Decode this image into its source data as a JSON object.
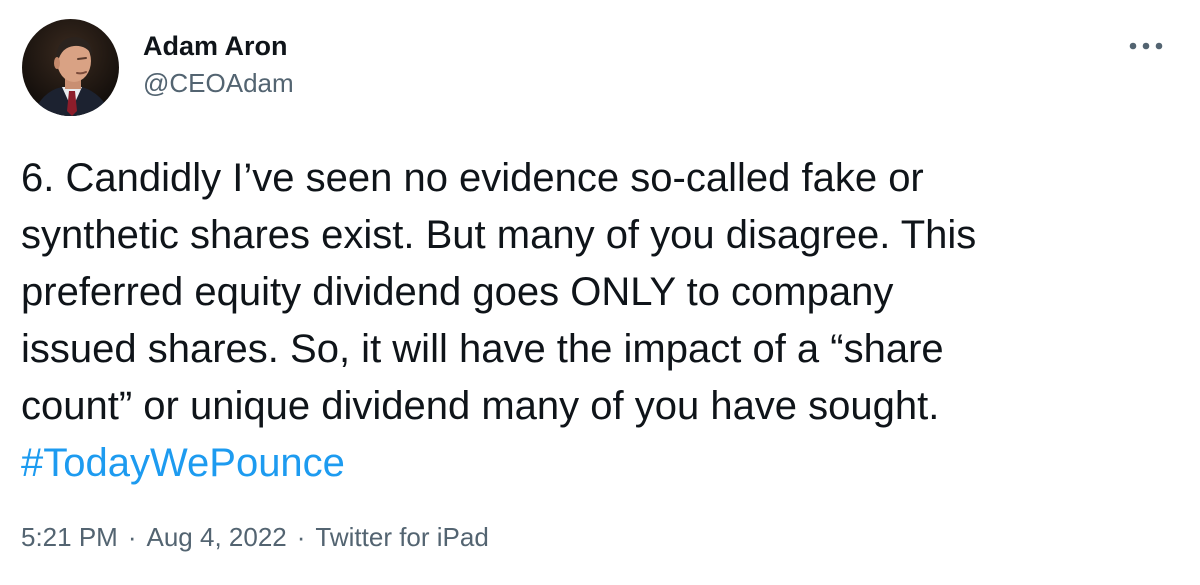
{
  "author": {
    "display_name": "Adam Aron",
    "handle": "@CEOAdam"
  },
  "tweet": {
    "text": "6. Candidly I’ve seen no evidence so-called fake or\nsynthetic shares exist. But many of you disagree. This\npreferred equity dividend goes ONLY to company\nissued shares. So, it will have the impact of a “share\ncount” or unique dividend many of you have sought.",
    "hashtag": "#TodayWePounce"
  },
  "meta": {
    "time": "5:21 PM",
    "separator": "·",
    "date": "Aug 4, 2022",
    "source": "Twitter for iPad"
  },
  "colors": {
    "link": "#1d9bf0",
    "secondary_text": "#536471",
    "primary_text": "#0f1419"
  },
  "icons": {
    "more": "more-options-icon"
  }
}
